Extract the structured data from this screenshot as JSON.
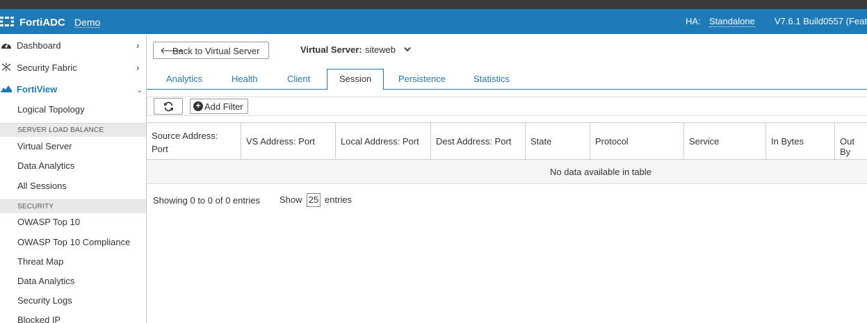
{
  "header": {
    "brand": "FortiADC",
    "tenant": "Demo",
    "ha_label": "HA:",
    "ha_value": "Standalone",
    "version": "V7.6.1 Build0557 (Feat"
  },
  "sidebar": {
    "top_items": [
      {
        "label": "Dashboard",
        "icon": "dashboard-icon",
        "chevron": ">"
      },
      {
        "label": "Security Fabric",
        "icon": "security-fabric-icon",
        "chevron": ">"
      },
      {
        "label": "FortiView",
        "icon": "fortiview-icon",
        "chevron": "v"
      }
    ],
    "fortiview_items": [
      "Logical Topology"
    ],
    "section_slb": "SERVER LOAD BALANCE",
    "slb_items": [
      "Virtual Server",
      "Data Analytics",
      "All Sessions"
    ],
    "section_security": "SECURITY",
    "security_items": [
      "OWASP Top 10",
      "OWASP Top 10 Compliance",
      "Threat Map",
      "Data Analytics",
      "Security Logs",
      "Blocked IP"
    ]
  },
  "main": {
    "back_button": "Back to Virtual Server",
    "vs_label": "Virtual Server:",
    "vs_value": "siteweb",
    "tabs": [
      "Analytics",
      "Health",
      "Client",
      "Session",
      "Persistence",
      "Statistics"
    ],
    "active_tab": "Session",
    "add_filter": "Add Filter",
    "columns": [
      "Source Address: Port",
      "VS Address: Port",
      "Local Address: Port",
      "Dest Address: Port",
      "State",
      "Protocol",
      "Service",
      "In Bytes",
      "Out By"
    ],
    "empty_message": "No data available in table",
    "info": "Showing 0 to 0 of 0 entries",
    "show_label": "Show",
    "page_size": "25",
    "entries_label": "entries"
  },
  "colors": {
    "header": "#1f7bb8",
    "accent": "#1f7bb8",
    "topstrip": "#3a3a3a"
  }
}
